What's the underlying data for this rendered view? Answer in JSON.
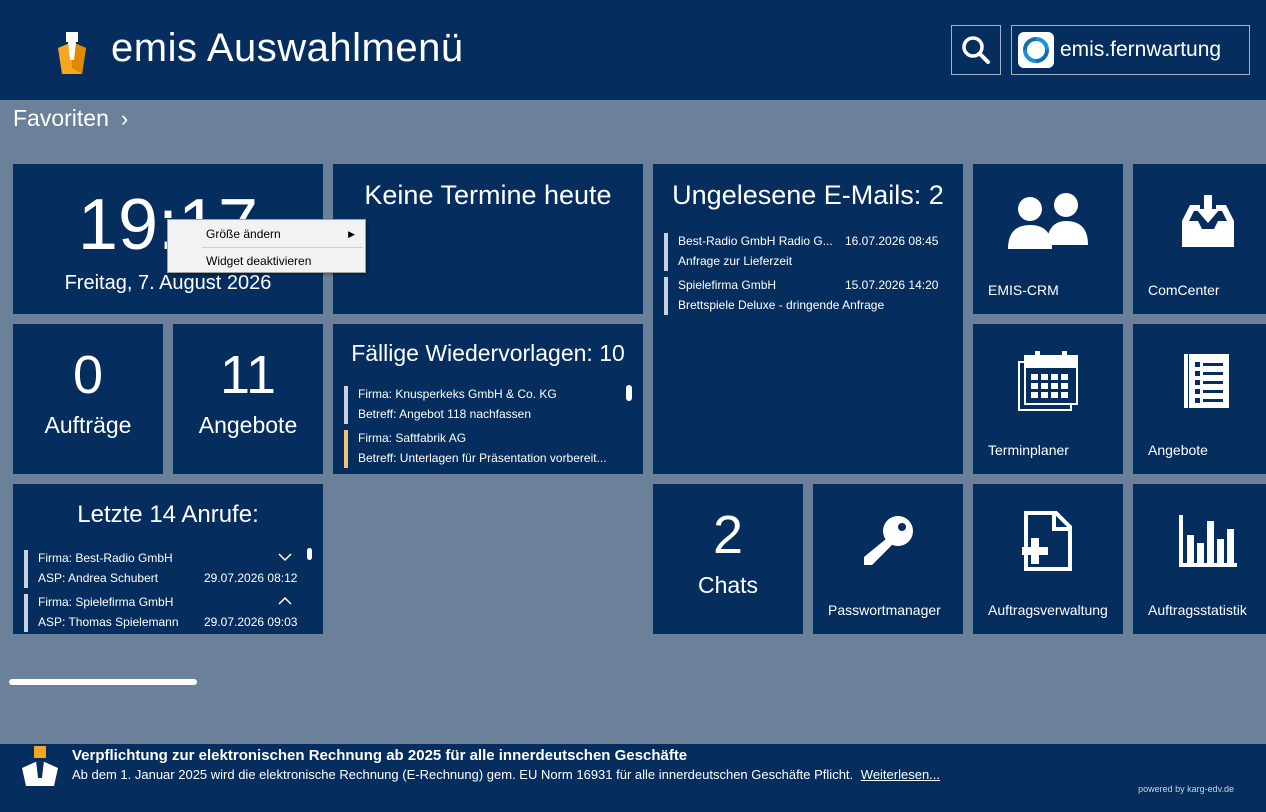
{
  "header": {
    "title": "emis Auswahlmenü",
    "remote_label": "emis.fernwartung"
  },
  "favorites": {
    "title": "Favoriten",
    "chevron": "›"
  },
  "clock": {
    "time": "19:17",
    "date": "Freitag, 7. August 2026"
  },
  "appointments": {
    "title": "Keine Termine heute"
  },
  "emails": {
    "title": "Ungelesene E-Mails: 2",
    "items": [
      {
        "from": "Best-Radio GmbH Radio G...",
        "date": "16.07.2026 08:45",
        "subject": "Anfrage zur Lieferzeit"
      },
      {
        "from": "Spielefirma GmbH",
        "date": "15.07.2026 14:20",
        "subject": "Brettspiele Deluxe - dringende Anfrage"
      }
    ]
  },
  "orders": {
    "count": "0",
    "label": "Aufträge"
  },
  "offers": {
    "count": "11",
    "label": "Angebote"
  },
  "followups": {
    "title": "Fällige Wiedervorlagen: 10",
    "items": [
      {
        "company": "Firma: Knusperkeks GmbH & Co. KG",
        "subject": "Betreff: Angebot 118 nachfassen"
      },
      {
        "company": "Firma: Saftfabrik AG",
        "subject": "Betreff: Unterlagen für Präsentation vorbereit..."
      }
    ]
  },
  "calls": {
    "title": "Letzte 14 Anrufe:",
    "items": [
      {
        "company": "Firma: Best-Radio GmbH",
        "contact": "ASP: Andrea Schubert",
        "date": "29.07.2026 08:12"
      },
      {
        "company": "Firma: Spielefirma GmbH",
        "contact": "ASP: Thomas Spielemann",
        "date": "29.07.2026 09:03"
      }
    ]
  },
  "chats": {
    "count": "2",
    "label": "Chats"
  },
  "apps": {
    "crm": "EMIS-CRM",
    "comcenter": "ComCenter",
    "termin": "Terminplaner",
    "angebote": "Angebote",
    "passwort": "Passwortmanager",
    "auftrag": "Auftragsverwaltung",
    "statistik": "Auftragsstatistik"
  },
  "context_menu": {
    "resize": "Größe ändern",
    "disable": "Widget deaktivieren"
  },
  "footer": {
    "title": "Verpflichtung zur elektronischen Rechnung ab 2025 für alle innerdeutschen Geschäfte",
    "text": "Ab dem 1. Januar 2025 wird die  elektronische Rechnung (E-Rechnung) gem. EU Norm 16931 für alle innerdeutschen Geschäfte Pflicht.",
    "more": "Weiterlesen...",
    "powered": "powered by karg-edv.de"
  },
  "colors": {
    "tile": "#052e5e",
    "background": "#6b8099",
    "accent_yellow": "#f0c27a"
  }
}
